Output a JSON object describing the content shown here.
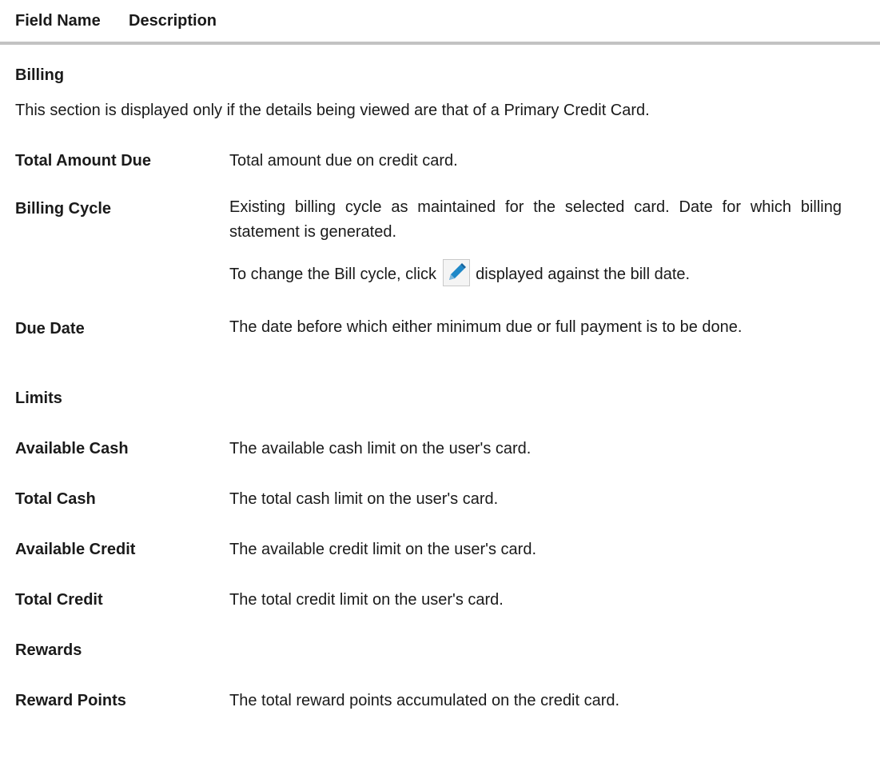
{
  "table": {
    "header": {
      "field": "Field Name",
      "description": "Description"
    }
  },
  "billing": {
    "title": "Billing",
    "note": "This section is displayed only if the details being viewed are that of a Primary Credit Card.",
    "total_amount_due": {
      "name": "Total Amount Due",
      "desc": "Total amount due on credit card."
    },
    "billing_cycle": {
      "name": "Billing Cycle",
      "desc": "Existing billing cycle as maintained for the selected card. Date for which billing statement is generated.",
      "change_before": "To change the Bill cycle, click",
      "change_after": "displayed against the bill date.",
      "icon": "pencil-edit-icon"
    },
    "due_date": {
      "name": "Due Date",
      "desc": "The date before which either minimum due or full payment is to be done."
    }
  },
  "limits": {
    "title": "Limits",
    "available_cash": {
      "name": "Available Cash",
      "desc": "The available cash limit on the user's card."
    },
    "total_cash": {
      "name": "Total Cash",
      "desc": "The total cash limit on the user's card."
    },
    "available_credit": {
      "name": "Available Credit",
      "desc": "The available credit limit on the user's card."
    },
    "total_credit": {
      "name": "Total Credit",
      "desc": "The total credit limit on the user's card."
    }
  },
  "rewards": {
    "title": "Rewards",
    "reward_points": {
      "name": "Reward Points",
      "desc": "The total reward points accumulated on the credit card."
    }
  },
  "colors": {
    "text": "#1a1a1a",
    "header_rule": "#c3c3c3",
    "icon_blue": "#1e88c8"
  }
}
